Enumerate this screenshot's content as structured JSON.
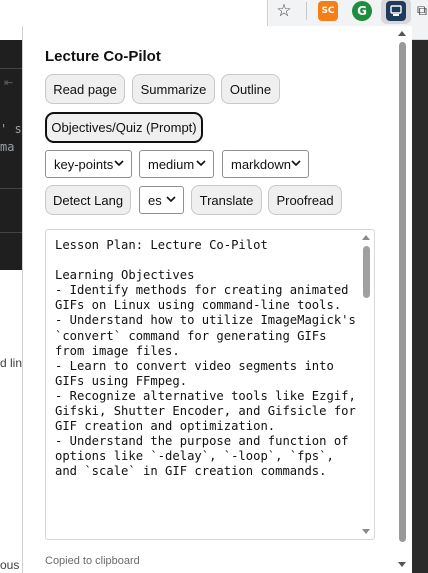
{
  "browser": {
    "extensions": [
      {
        "name": "sc",
        "label": "SC"
      },
      {
        "name": "grammarly",
        "label": "G"
      },
      {
        "name": "lecture-copilot",
        "label": ""
      }
    ]
  },
  "background": {
    "snippets": [
      "' sy",
      "ma",
      "d line",
      "ous"
    ],
    "icon": "⇤"
  },
  "popup": {
    "title": "Lecture Co-Pilot",
    "buttons_row1": {
      "read_page": "Read page",
      "summarize": "Summarize",
      "outline": "Outline"
    },
    "objectives_button": "Objectives/Quiz (Prompt)",
    "selects": {
      "mode": "key-points",
      "length": "medium",
      "format": "markdown",
      "language": "es"
    },
    "buttons_row4": {
      "detect_lang": "Detect Lang",
      "translate": "Translate",
      "proofread": "Proofread"
    },
    "output_text": "Lesson Plan: Lecture Co-Pilot\n\nLearning Objectives\n- Identify methods for creating animated GIFs on Linux using command-line tools.\n- Understand how to utilize ImageMagick's `convert` command for generating GIFs from image files.\n- Learn to convert video segments into GIFs using FFmpeg.\n- Recognize alternative tools like Ezgif, Gifski, Shutter Encoder, and Gifsicle for GIF creation and optimization.\n- Understand the purpose and function of options like `-delay`, `-loop`, `fps`, and `scale` in GIF creation commands.",
    "status": "Copied to clipboard"
  }
}
